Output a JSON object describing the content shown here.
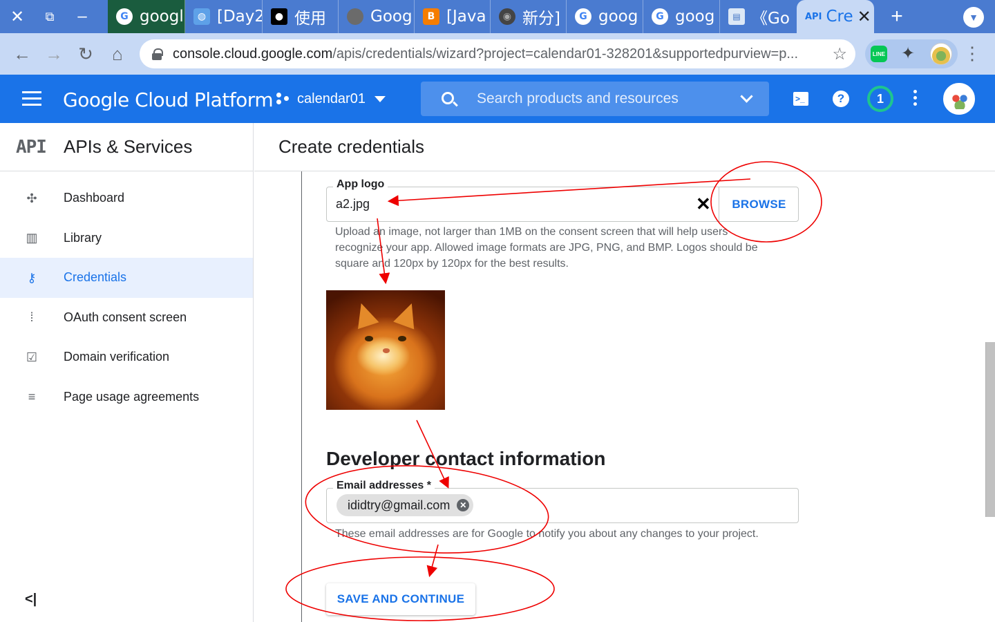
{
  "browser": {
    "tabs": [
      {
        "title": "googl",
        "icon": "google-icon"
      },
      {
        "title": "[Day2",
        "icon": "blue-site-icon"
      },
      {
        "title": "使用",
        "icon": "medium-icon"
      },
      {
        "title": "Goog",
        "icon": "gray-site-icon"
      },
      {
        "title": "[Java",
        "icon": "blogger-icon"
      },
      {
        "title": "新分]",
        "icon": "chrome-icon"
      },
      {
        "title": "goog",
        "icon": "google-icon"
      },
      {
        "title": "goog",
        "icon": "google-icon"
      },
      {
        "title": "《Go",
        "icon": "doc-icon"
      },
      {
        "title": "Cre",
        "icon": "api-icon",
        "favicon_text": "API"
      }
    ],
    "url_host": "console.cloud.google.com",
    "url_path": "/apis/credentials/wizard?project=calendar01-328201&supportedpurview=p...",
    "extension_line_label": "LINE"
  },
  "header": {
    "brand": "Google Cloud Platform",
    "project": "calendar01",
    "search_placeholder": "Search products and resources",
    "notification_count": "1",
    "colors": {
      "header_bg": "#1a73e8",
      "accent": "#1a73e8"
    }
  },
  "sidebar": {
    "logo_text": "API",
    "title": "APIs & Services",
    "items": [
      {
        "label": "Dashboard",
        "icon": "dashboard-icon",
        "active": false
      },
      {
        "label": "Library",
        "icon": "library-icon",
        "active": false
      },
      {
        "label": "Credentials",
        "icon": "key-icon",
        "active": true
      },
      {
        "label": "OAuth consent screen",
        "icon": "consent-icon",
        "active": false
      },
      {
        "label": "Domain verification",
        "icon": "checkbox-icon",
        "active": false
      },
      {
        "label": "Page usage agreements",
        "icon": "settings-list-icon",
        "active": false
      }
    ]
  },
  "main": {
    "title": "Create credentials",
    "app_logo": {
      "label": "App logo",
      "value": "a2.jpg",
      "browse_label": "BROWSE",
      "helper": "Upload an image, not larger than 1MB on the consent screen that will help users recognize your app. Allowed image formats are JPG, PNG, and BMP. Logos should be square and 120px by 120px for the best results."
    },
    "developer_contact": {
      "title": "Developer contact information",
      "email_label": "Email addresses *",
      "emails": [
        "ididtry@gmail.com"
      ],
      "helper": "These email addresses are for Google to notify you about any changes to your project."
    },
    "save_label": "SAVE AND CONTINUE"
  }
}
